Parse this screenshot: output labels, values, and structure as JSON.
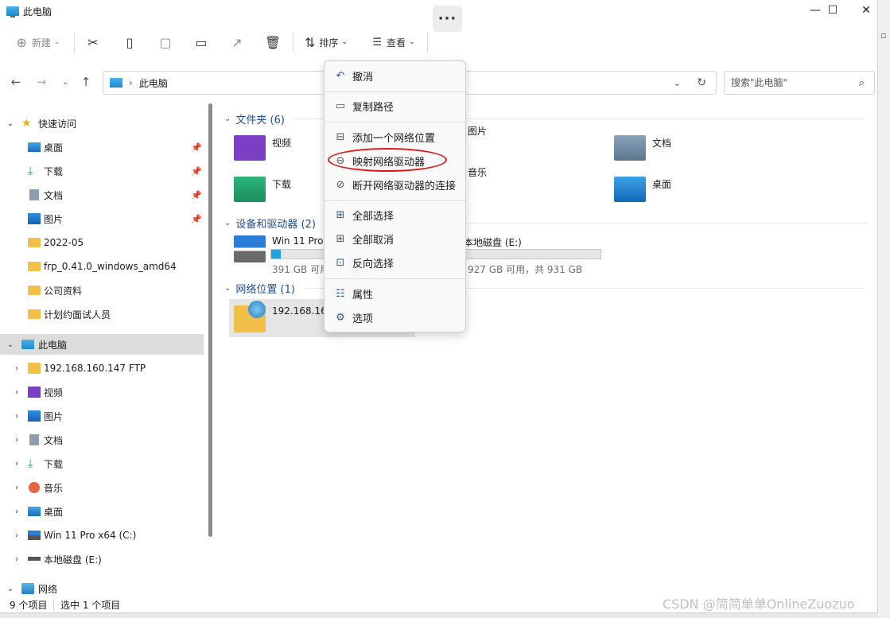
{
  "window": {
    "title": "此电脑"
  },
  "toolbar": {
    "new_label": "新建",
    "sort_label": "排序",
    "view_label": "查看",
    "more_label": "···"
  },
  "address": {
    "path": "此电脑",
    "search_placeholder": "搜索\"此电脑\""
  },
  "nav": {
    "quick_access": "快速访问",
    "quick_items": [
      {
        "label": "桌面",
        "pinned": true
      },
      {
        "label": "下载",
        "pinned": true
      },
      {
        "label": "文档",
        "pinned": true
      },
      {
        "label": "图片",
        "pinned": true
      },
      {
        "label": "2022-05"
      },
      {
        "label": "frp_0.41.0_windows_amd64"
      },
      {
        "label": "公司资料"
      },
      {
        "label": "计划约面试人员"
      }
    ],
    "this_pc": "此电脑",
    "pc_items": [
      {
        "label": "192.168.160.147   FTP"
      },
      {
        "label": "视频"
      },
      {
        "label": "图片"
      },
      {
        "label": "文档"
      },
      {
        "label": "下载"
      },
      {
        "label": "音乐"
      },
      {
        "label": "桌面"
      },
      {
        "label": "Win 11 Pro x64 (C:)"
      },
      {
        "label": "本地磁盘 (E:)"
      }
    ],
    "network": "网络"
  },
  "content": {
    "folders_header": "文件夹 (6)",
    "folders": [
      {
        "label": "视频"
      },
      {
        "label": "图片"
      },
      {
        "label": "文档"
      },
      {
        "label": "下载"
      },
      {
        "label": "音乐"
      },
      {
        "label": "桌面"
      }
    ],
    "devices_header": "设备和驱动器 (2)",
    "drives": [
      {
        "name": "Win 11 Pro x64 (C:)",
        "free_text": "391 GB 可用，共 475 GB",
        "used_fraction": 0.18
      },
      {
        "name": "本地磁盘 (E:)",
        "free_text": "927 GB 可用，共 931 GB",
        "used_fraction": 0.01
      }
    ],
    "network_header": "网络位置 (1)",
    "network_items": [
      {
        "label": "192.168.160.147"
      }
    ]
  },
  "context_menu": {
    "items": [
      {
        "label": "撤消"
      },
      {
        "label": "复制路径"
      },
      {
        "label": "添加一个网络位置"
      },
      {
        "label": "映射网络驱动器",
        "highlighted": true
      },
      {
        "label": "断开网络驱动器的连接"
      },
      {
        "label": "全部选择"
      },
      {
        "label": "全部取消"
      },
      {
        "label": "反向选择"
      },
      {
        "label": "属性"
      },
      {
        "label": "选项"
      }
    ]
  },
  "status": {
    "count": "9 个项目",
    "selected": "选中 1 个项目"
  },
  "watermark": "CSDN @简简单单OnlineZuozuo",
  "colors": {
    "accent": "#26a0da",
    "highlight_circle": "#e01a1a",
    "section_header": "#1f4e99"
  }
}
